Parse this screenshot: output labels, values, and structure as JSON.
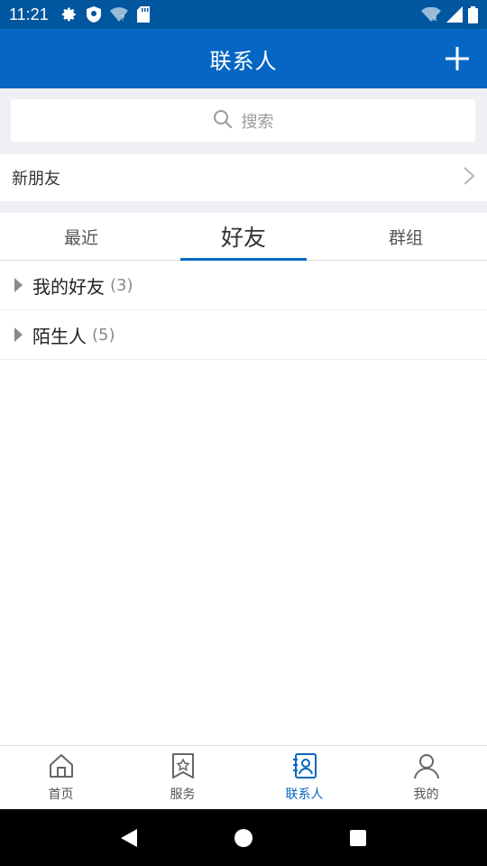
{
  "status_bar": {
    "time": "11:21",
    "icons": [
      "settings-icon",
      "shield-icon",
      "wifi-question-icon",
      "sd-card-icon",
      "wifi-x-icon",
      "signal-icon",
      "battery-icon"
    ]
  },
  "app_bar": {
    "title": "联系人",
    "add_icon": "plus-icon"
  },
  "search": {
    "placeholder": "搜索",
    "icon": "search-icon"
  },
  "new_friends": {
    "label": "新朋友",
    "icon": "chevron-right-icon"
  },
  "tabs": [
    {
      "label": "最近",
      "active": false
    },
    {
      "label": "好友",
      "active": true
    },
    {
      "label": "群组",
      "active": false
    }
  ],
  "groups": [
    {
      "name": "我的好友",
      "count": "(3)"
    },
    {
      "name": "陌生人",
      "count": "(5)"
    }
  ],
  "bottom_nav": [
    {
      "label": "首页",
      "icon": "home-icon",
      "active": false
    },
    {
      "label": "服务",
      "icon": "service-star-icon",
      "active": false
    },
    {
      "label": "联系人",
      "icon": "contacts-icon",
      "active": true
    },
    {
      "label": "我的",
      "icon": "person-icon",
      "active": false
    }
  ],
  "colors": {
    "primary": "#0567c3",
    "status_bar": "#00569f",
    "background_gray": "#efeff4"
  }
}
